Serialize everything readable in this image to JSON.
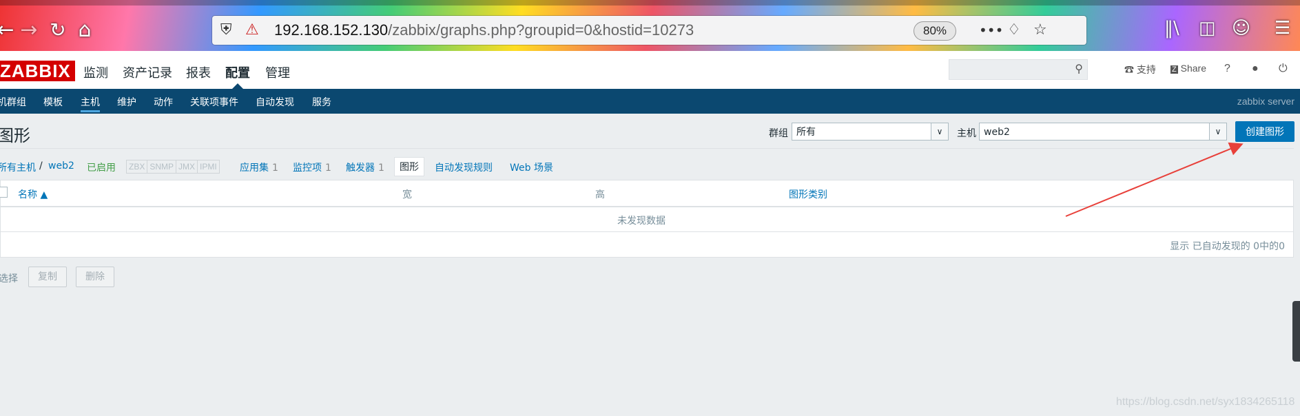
{
  "browser": {
    "url_host": "192.168.152.130",
    "url_path": "/zabbix/graphs.php?groupid=0&hostid=10273",
    "zoom": "80%",
    "icons": [
      "back-icon",
      "forward-icon",
      "reload-icon",
      "home-icon",
      "shield-icon",
      "insecure-lock-icon",
      "more-icon",
      "pocket-icon",
      "star-icon",
      "library-icon",
      "sidebar-icon",
      "account-icon",
      "menu-icon"
    ]
  },
  "header": {
    "logo": "ZABBIX",
    "menu": [
      "监测",
      "资产记录",
      "报表",
      "配置",
      "管理"
    ],
    "support": "支持",
    "share": "Share",
    "help": "?"
  },
  "subnav": {
    "items": [
      "机群组",
      "模板",
      "主机",
      "维护",
      "动作",
      "关联项事件",
      "自动发现",
      "服务"
    ],
    "server_name": "zabbix server"
  },
  "page": {
    "title": "图形",
    "group_label": "群组",
    "group_value": "所有",
    "host_label": "主机",
    "host_value": "web2",
    "create_button": "创建图形"
  },
  "host_nav": {
    "all_hosts": "所有主机",
    "separator": "/",
    "host": "web2",
    "status": "已启用",
    "protocols": [
      "ZBX",
      "SNMP",
      "JMX",
      "IPMI"
    ],
    "app_label": "应用集",
    "app_count": "1",
    "items_label": "监控项",
    "items_count": "1",
    "triggers_label": "触发器",
    "triggers_count": "1",
    "graphs_label": "图形",
    "discovery_label": "自动发现规则",
    "web_label": "Web 场景"
  },
  "table": {
    "columns": [
      "名称 ▲",
      "宽",
      "高",
      "图形类别"
    ],
    "empty_text": "未发现数据",
    "summary": "显示 已自动发现的 0中的0"
  },
  "footer": {
    "selected": "选择",
    "copy": "复制",
    "delete": "删除"
  },
  "colors": {
    "accent": "#0275b8",
    "subnav_bg": "#0b4870",
    "enabled_green": "#429e47",
    "logo_red": "#d40000",
    "annotation_red": "#e8403a"
  },
  "watermark": "https://blog.csdn.net/syx1834265118"
}
